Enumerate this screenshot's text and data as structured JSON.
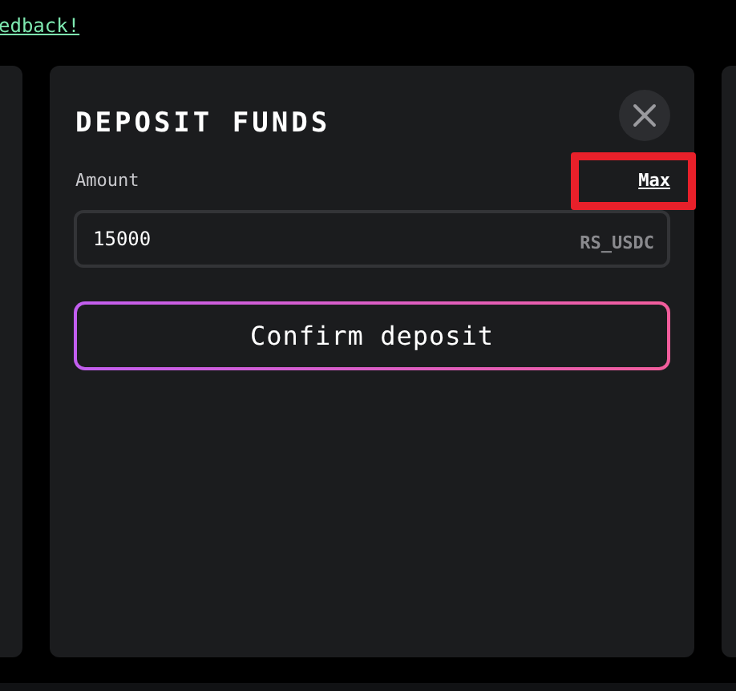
{
  "top_link": "edback!",
  "modal": {
    "title": "DEPOSIT FUNDS",
    "amount_label": "Amount",
    "max_link": "Max",
    "max_highlighted": true,
    "amount_value": "15000",
    "currency": "RS_USDC",
    "confirm_button": "Confirm deposit"
  }
}
